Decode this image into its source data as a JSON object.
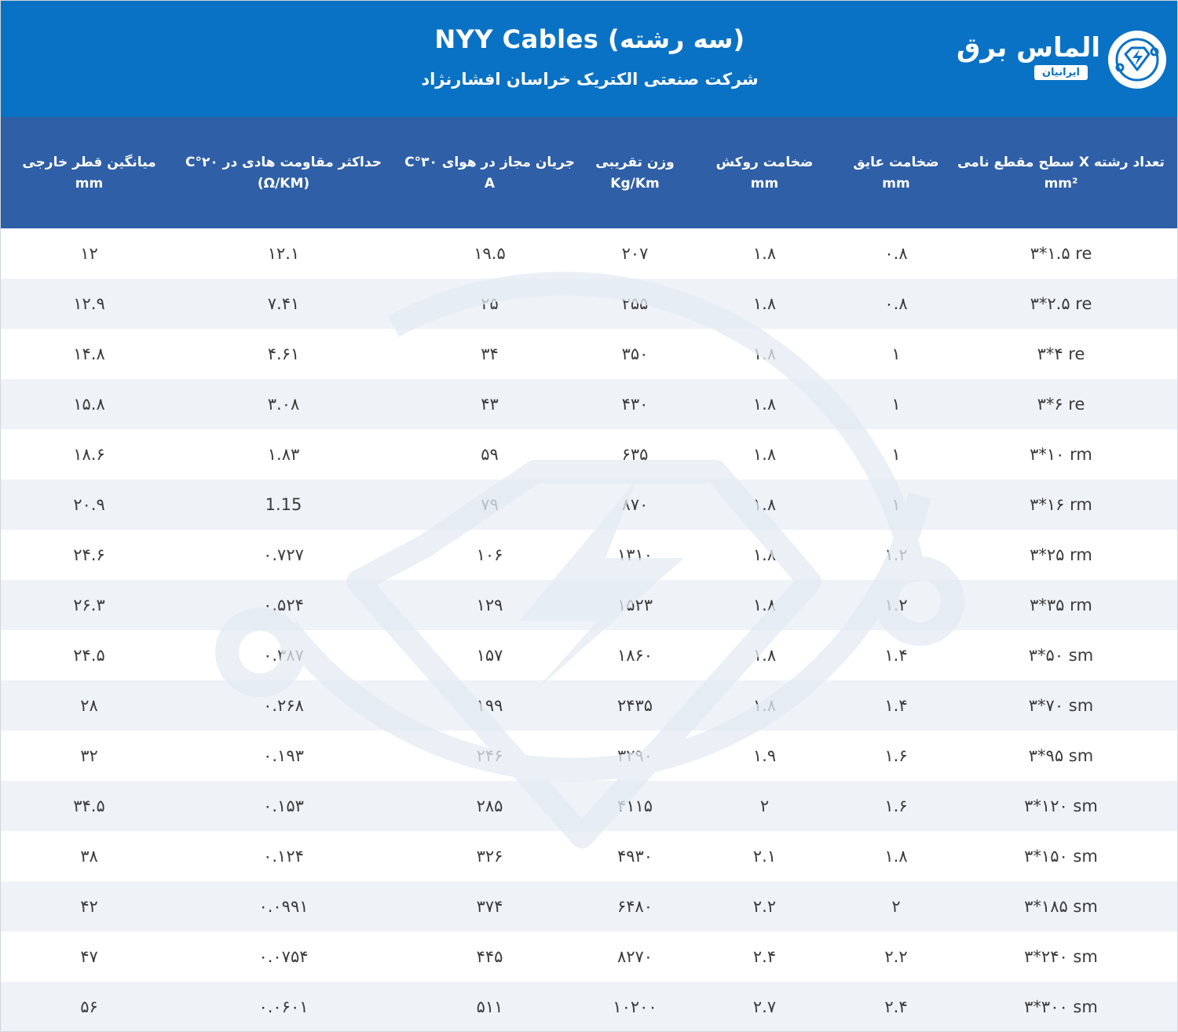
{
  "header": {
    "title": "NYY Cables (سه رشته)",
    "subtitle": "شرکت صنعتی الکتریک خراسان افشارنژاد",
    "logo_text": "الماس برق",
    "logo_sub": "ایرانیان",
    "background": "#0a72c4"
  },
  "table": {
    "header_background": "#2f5fa6",
    "columns": [
      {
        "line1": "تعداد رشته X سطح مقطع نامی",
        "line2": "mm²"
      },
      {
        "line1": "ضخامت عایق",
        "line2": "mm"
      },
      {
        "line1": "ضخامت روکش",
        "line2": "mm"
      },
      {
        "line1": "وزن تقریبی",
        "line2": "Kg/Km"
      },
      {
        "line1": "جریان مجاز در هوای ۳۰°C",
        "line2": "A"
      },
      {
        "line1": "حداکثر مقاومت هادی در ۲۰°C",
        "line2": "(Ω/KM)"
      },
      {
        "line1": "میانگین قطر خارجی",
        "line2": "mm"
      }
    ],
    "rows": [
      [
        "۳*۱.۵ re",
        "۰.۸",
        "۱.۸",
        "۲۰۷",
        "۱۹.۵",
        "۱۲.۱",
        "۱۲"
      ],
      [
        "۳*۲.۵ re",
        "۰.۸",
        "۱.۸",
        "۲۵۵",
        "۲۵",
        "۷.۴۱",
        "۱۲.۹"
      ],
      [
        "۳*۴ re",
        "۱",
        "۱.۸",
        "۳۵۰",
        "۳۴",
        "۴.۶۱",
        "۱۴.۸"
      ],
      [
        "۳*۶ re",
        "۱",
        "۱.۸",
        "۴۳۰",
        "۴۳",
        "۳.۰۸",
        "۱۵.۸"
      ],
      [
        "۳*۱۰ rm",
        "۱",
        "۱.۸",
        "۶۳۵",
        "۵۹",
        "۱.۸۳",
        "۱۸.۶"
      ],
      [
        "۳*۱۶ rm",
        "۱",
        "۱.۸",
        "۸۷۰",
        "۷۹",
        "1.15",
        "۲۰.۹"
      ],
      [
        "۳*۲۵ rm",
        "۱.۲",
        "۱.۸",
        "۱۳۱۰",
        "۱۰۶",
        "۰.۷۲۷",
        "۲۴.۶"
      ],
      [
        "۳*۳۵ rm",
        "۱.۲",
        "۱.۸",
        "۱۵۲۳",
        "۱۲۹",
        "۰.۵۲۴",
        "۲۶.۳"
      ],
      [
        "۳*۵۰ sm",
        "۱.۴",
        "۱.۸",
        "۱۸۶۰",
        "۱۵۷",
        "۰.۳۸۷",
        "۲۴.۵"
      ],
      [
        "۳*۷۰ sm",
        "۱.۴",
        "۱.۸",
        "۲۴۳۵",
        "۱۹۹",
        "۰.۲۶۸",
        "۲۸"
      ],
      [
        "۳*۹۵ sm",
        "۱.۶",
        "۱.۹",
        "۳۲۹۰",
        "۲۴۶",
        "۰.۱۹۳",
        "۳۲"
      ],
      [
        "۳*۱۲۰ sm",
        "۱.۶",
        "۲",
        "۴۱۱۵",
        "۲۸۵",
        "۰.۱۵۳",
        "۳۴.۵"
      ],
      [
        "۳*۱۵۰ sm",
        "۱.۸",
        "۲.۱",
        "۴۹۳۰",
        "۳۲۶",
        "۰.۱۲۴",
        "۳۸"
      ],
      [
        "۳*۱۸۵ sm",
        "۲",
        "۲.۲",
        "۶۴۸۰",
        "۳۷۴",
        "۰.۰۹۹۱",
        "۴۲"
      ],
      [
        "۳*۲۴۰ sm",
        "۲.۲",
        "۲.۴",
        "۸۲۷۰",
        "۴۴۵",
        "۰.۰۷۵۴",
        "۴۷"
      ],
      [
        "۳*۳۰۰ sm",
        "۲.۴",
        "۲.۷",
        "۱۰۲۰۰",
        "۵۱۱",
        "۰.۰۶۰۱",
        "۵۶"
      ]
    ]
  }
}
